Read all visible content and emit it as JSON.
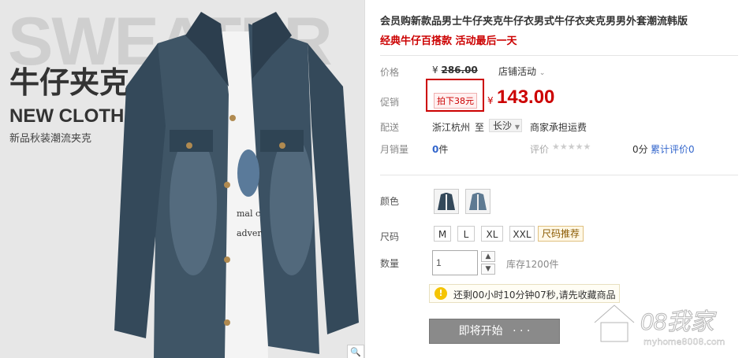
{
  "image": {
    "bg_text": "SWEATER",
    "cn_title": "牛仔夹克",
    "en_title": "NEW CLOTHE",
    "subtitle": "新品秋装潮流夹克",
    "zoom_icon": "magnifier-icon"
  },
  "product": {
    "title": "会员购新款品男士牛仔夹克牛仔衣男式牛仔衣夹克男男外套潮流韩版",
    "slogan": "经典牛仔百搭款 活动最后一天"
  },
  "price_row": {
    "label": "价格",
    "currency": "¥",
    "original": "286.00",
    "store_activity": "店铺活动",
    "dropdown_icon": "chevron-down-icon"
  },
  "promo_row": {
    "label": "促销",
    "tag": "拍下38元",
    "currency": "¥",
    "price": "143.00"
  },
  "shipping_row": {
    "label": "配送",
    "origin": "浙江杭州",
    "to": "至",
    "destination": "长沙",
    "fee": "商家承担运费"
  },
  "sales_row": {
    "label": "月销量",
    "count": "0",
    "unit": "件",
    "rating_label": "评价",
    "stars": "★★★★★",
    "rating_value": "0分",
    "reviews_link": "累计评价",
    "reviews_count": "0"
  },
  "color_row": {
    "label": "颜色"
  },
  "size_row": {
    "label": "尺码",
    "sizes": [
      "M",
      "L",
      "XL",
      "XXL"
    ],
    "recommend": "尺码推荐"
  },
  "qty_row": {
    "label": "数量",
    "value": "1",
    "stock": "库存1200件"
  },
  "notice": {
    "icon": "lightbulb-icon",
    "text": "还剩00小时10分钟07秒,请先收藏商品"
  },
  "buy": {
    "label": "即将开始",
    "dots": "· · ·"
  },
  "watermark": {
    "text": "08我家",
    "url": "myhome8008.com"
  },
  "colors": {
    "accent": "#cc0000",
    "link": "#3366cc",
    "button": "#8a8a8a"
  }
}
